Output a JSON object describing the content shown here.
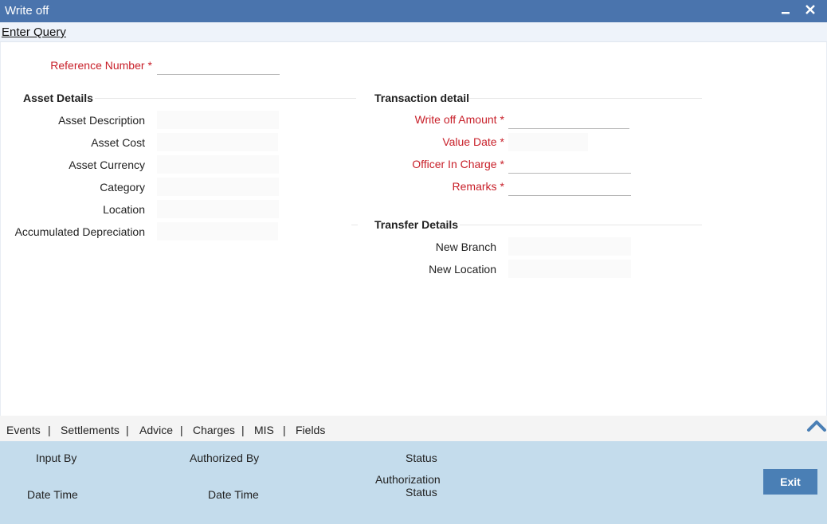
{
  "window": {
    "title": "Write off",
    "minimize_glyph": "▬",
    "close_glyph": "✕"
  },
  "toolbar": {
    "enter_query": "Enter Query"
  },
  "header": {
    "reference_number_label": "Reference Number",
    "reference_number_value": ""
  },
  "asset_details": {
    "title": "Asset Details",
    "fields": [
      {
        "label": "Asset Description",
        "value": ""
      },
      {
        "label": "Asset Cost",
        "value": ""
      },
      {
        "label": "Asset Currency",
        "value": ""
      },
      {
        "label": "Category",
        "value": ""
      },
      {
        "label": "Location",
        "value": ""
      },
      {
        "label": "Accumulated Depreciation",
        "value": ""
      }
    ]
  },
  "transaction_detail": {
    "title": "Transaction detail",
    "fields": [
      {
        "label": "Write off Amount",
        "value": "",
        "required": true
      },
      {
        "label": "Value Date",
        "value": "",
        "required": true
      },
      {
        "label": "Officer In Charge",
        "value": "",
        "required": true
      },
      {
        "label": "Remarks",
        "value": "",
        "required": true
      }
    ]
  },
  "transfer_details": {
    "title": "Transfer Details",
    "fields": [
      {
        "label": "New Branch",
        "value": ""
      },
      {
        "label": "New Location",
        "value": ""
      }
    ]
  },
  "required_marker": "*",
  "tabs": [
    "Events",
    "Settlements",
    "Advice",
    "Charges",
    "MIS",
    "Fields"
  ],
  "tab_separator": "|",
  "footer": {
    "input_by": "Input By",
    "date_time_1": "Date Time",
    "authorized_by": "Authorized By",
    "date_time_2": "Date Time",
    "status": "Status",
    "authorization_status_line1": "Authorization",
    "authorization_status_line2": "Status",
    "exit_label": "Exit"
  },
  "colors": {
    "title_bar": "#4a74ad",
    "required_label": "#c8202a",
    "footer_bg": "#c4dcec",
    "exit_button": "#4a7fb5"
  },
  "icons": {
    "collapse": "chevron-up-icon",
    "minimize": "minimize-icon",
    "close": "close-icon"
  }
}
